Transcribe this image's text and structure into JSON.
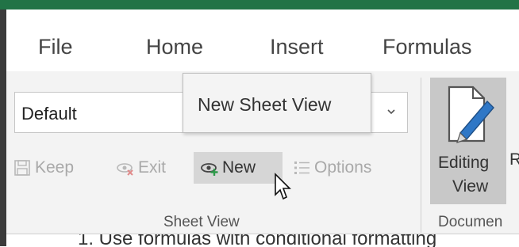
{
  "tabs": [
    "File",
    "Home",
    "Insert",
    "Formulas"
  ],
  "sheet_view": {
    "selected": "Default",
    "tooltip": "New Sheet View",
    "buttons": {
      "keep": "Keep",
      "exit": "Exit",
      "new": "New",
      "options": "Options"
    },
    "group_label": "Sheet View"
  },
  "editing_view": {
    "line1": "Editing",
    "line2": "View",
    "cut_text": "R"
  },
  "document_group_label": "Documen",
  "sheet_text": "1. Use formulas with conditional formatting",
  "colors": {
    "accent": "#217346",
    "ribbon_bg": "#f3f3f3",
    "pressed": "#d6d6d6"
  },
  "icons": [
    "chevron-down-icon",
    "keep-icon",
    "exit-icon",
    "new-view-icon",
    "options-icon",
    "editing-view-icon",
    "cursor-icon"
  ]
}
